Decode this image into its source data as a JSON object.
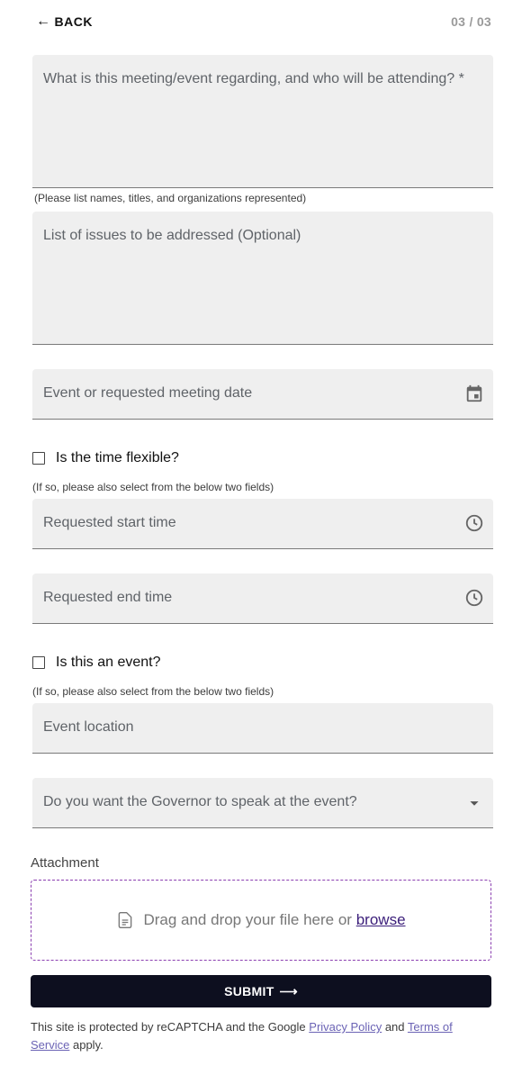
{
  "nav": {
    "back_label": "BACK",
    "back_arrow": "←",
    "step_indicator": "03 / 03"
  },
  "fields": {
    "regarding": {
      "placeholder": "What is this meeting/event regarding, and who will be attending? *",
      "helper": "(Please list names, titles, and organizations represented)"
    },
    "issues": {
      "placeholder": "List of issues to be addressed (Optional)"
    },
    "event_date": {
      "placeholder": "Event or requested meeting date",
      "icon": "calendar-icon"
    },
    "time_flexible": {
      "label": "Is the time flexible?",
      "checked": false,
      "helper": "(If so, please also select from the below two fields)"
    },
    "start_time": {
      "placeholder": "Requested start time",
      "icon": "clock-icon"
    },
    "end_time": {
      "placeholder": "Requested end time",
      "icon": "clock-icon"
    },
    "is_event": {
      "label": "Is this an event?",
      "checked": false,
      "helper": "(If so, please also select from the below two fields)"
    },
    "event_location": {
      "placeholder": "Event location"
    },
    "governor_speak": {
      "placeholder": "Do you want the Governor to speak at the event?",
      "icon": "dropdown-arrow-icon"
    }
  },
  "attachment": {
    "label": "Attachment",
    "drop_text": "Drag and drop your file here or",
    "browse_label": "browse",
    "icon": "document-icon"
  },
  "submit": {
    "label": "SUBMIT",
    "arrow": "⟶"
  },
  "recaptcha": {
    "prefix": "This site is protected by reCAPTCHA and the Google",
    "privacy_label": "Privacy Policy",
    "and": "and",
    "terms_label": "Terms of Service",
    "suffix": "apply."
  },
  "colors": {
    "field_bg": "#efefef",
    "submit_bg": "#0d0f1f",
    "dropzone_border": "#8b3fb0",
    "link": "#6b63b5"
  }
}
